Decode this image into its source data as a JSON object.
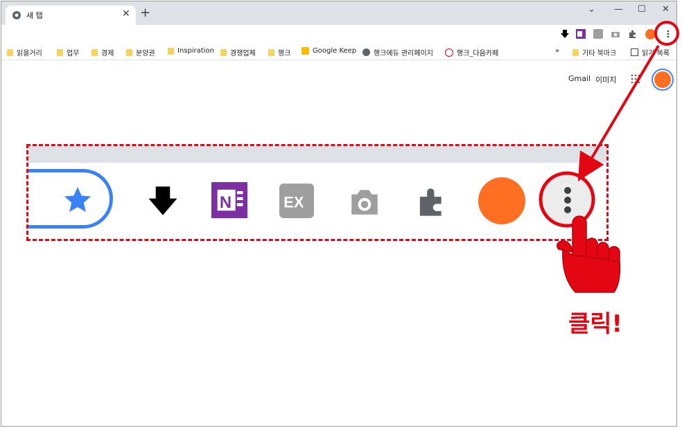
{
  "tab": {
    "title": "새 탭"
  },
  "bookmarks": [
    {
      "label": "읽을거리",
      "type": "folder"
    },
    {
      "label": "업무",
      "type": "folder"
    },
    {
      "label": "경제",
      "type": "folder"
    },
    {
      "label": "분양권",
      "type": "folder"
    },
    {
      "label": "Inspiration",
      "type": "folder"
    },
    {
      "label": "경쟁업체",
      "type": "folder"
    },
    {
      "label": "행크",
      "type": "folder"
    },
    {
      "label": "Google Keep",
      "type": "link"
    },
    {
      "label": "행크에듀 관리페이지",
      "type": "link"
    },
    {
      "label": "행크_다음카페",
      "type": "link"
    }
  ],
  "bookmarks_overflow": "»",
  "other_bookmarks": "기타 북마크",
  "reading_list": "읽기 목록",
  "header_links": {
    "gmail": "Gmail",
    "images": "이미지"
  },
  "callout": "클릭!",
  "colors": {
    "accent_red": "#e30613",
    "chrome_blue": "#3b82f6",
    "avatar_orange": "#ff6f22"
  }
}
